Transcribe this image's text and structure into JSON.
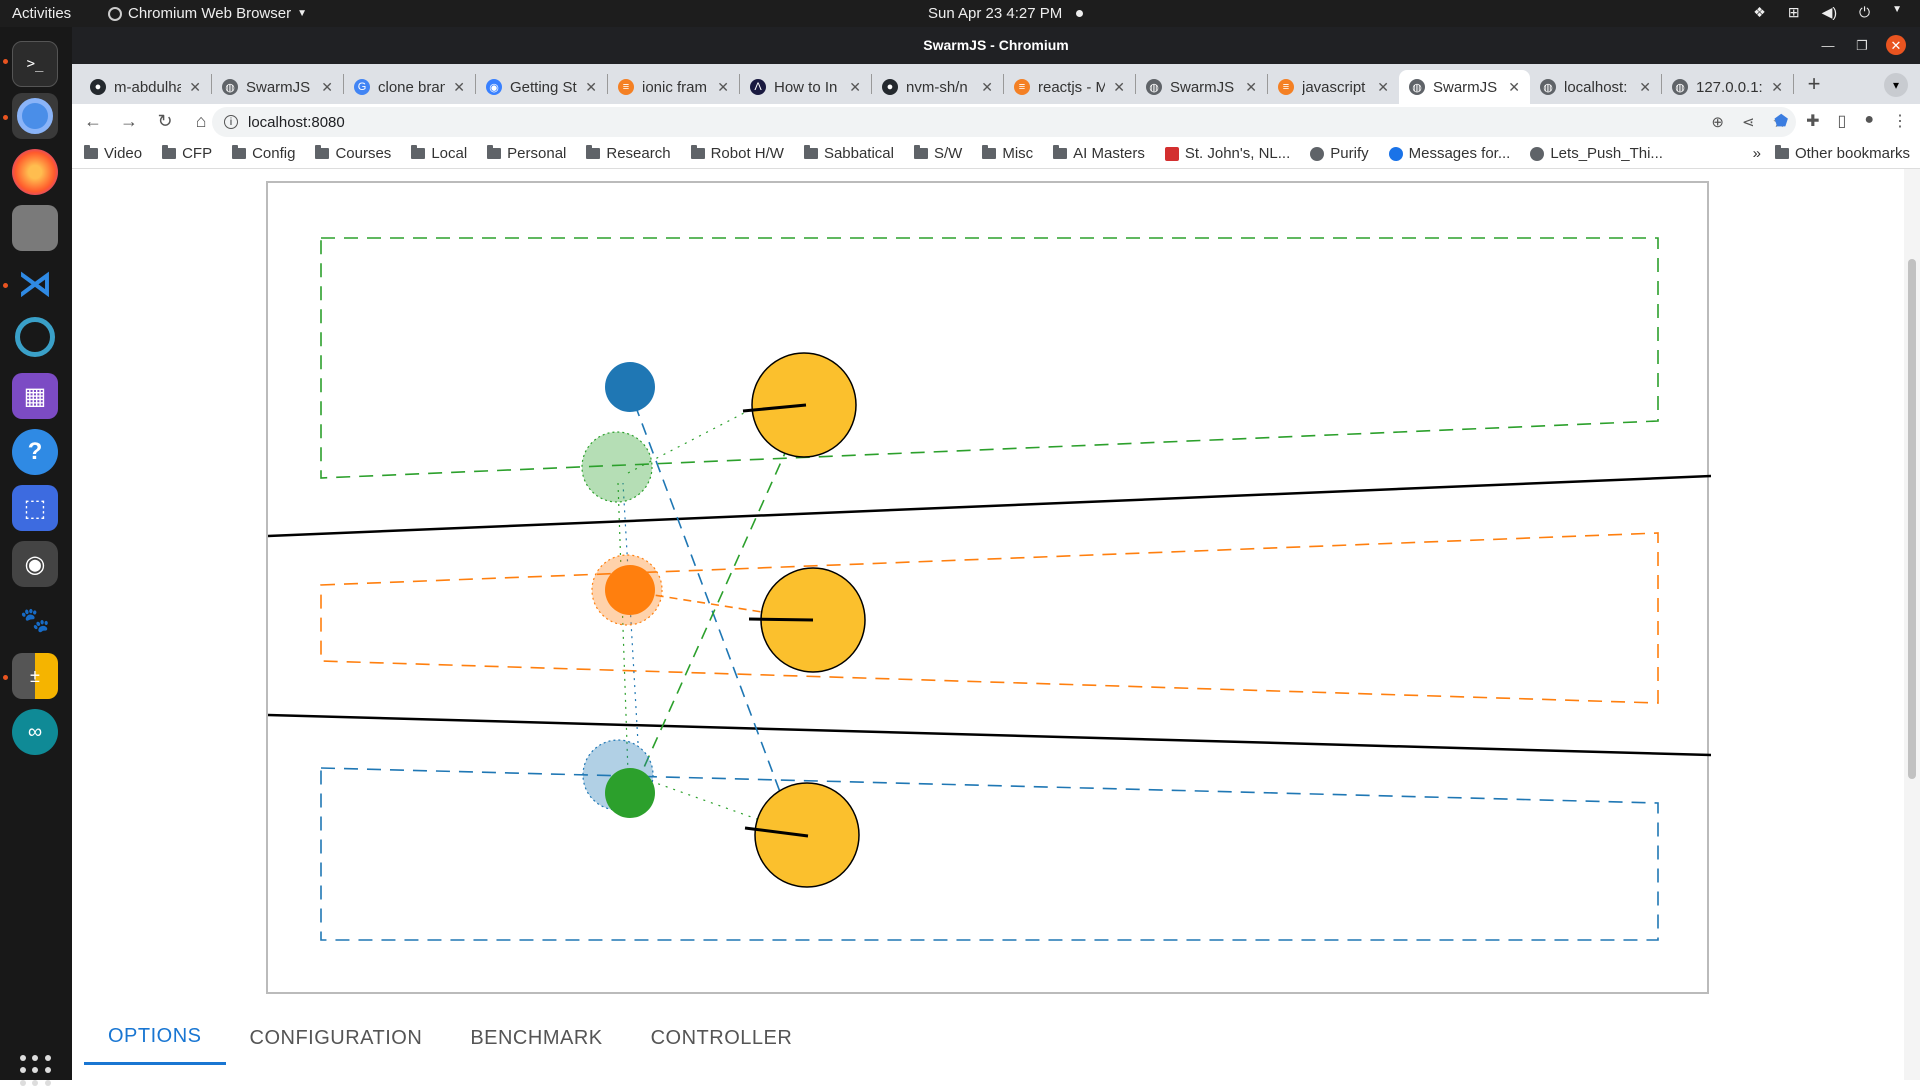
{
  "system_bar": {
    "activities": "Activities",
    "app_name": "Chromium Web Browser",
    "clock": "Sun Apr 23  4:27 PM"
  },
  "dock": {
    "apps": [
      "terminal",
      "chromium",
      "firefox",
      "files",
      "vscode",
      "settings-ring",
      "video-recorder",
      "help",
      "screenshot",
      "camera",
      "gimp",
      "calculator",
      "arduino"
    ]
  },
  "browser": {
    "window_title": "SwarmJS - Chromium",
    "tabs": [
      {
        "label": "m-abdulha",
        "icon": "github-icon",
        "active": false
      },
      {
        "label": "SwarmJS",
        "icon": "globe-icon",
        "active": false
      },
      {
        "label": "clone bran",
        "icon": "google-icon",
        "active": false
      },
      {
        "label": "Getting St",
        "icon": "ionic-icon",
        "active": false
      },
      {
        "label": "ionic fram",
        "icon": "stackoverflow-icon",
        "active": false
      },
      {
        "label": "How to In",
        "icon": "dev-icon",
        "active": false
      },
      {
        "label": "nvm-sh/n",
        "icon": "github-icon",
        "active": false
      },
      {
        "label": "reactjs - M",
        "icon": "stackoverflow-icon",
        "active": false
      },
      {
        "label": "SwarmJS",
        "icon": "globe-icon",
        "active": false
      },
      {
        "label": "javascript",
        "icon": "stackoverflow-icon",
        "active": false
      },
      {
        "label": "SwarmJS",
        "icon": "globe-icon",
        "active": true
      },
      {
        "label": "localhost:",
        "icon": "globe-icon",
        "active": false
      },
      {
        "label": "127.0.0.1:",
        "icon": "globe-icon",
        "active": false
      }
    ],
    "address": "localhost:8080",
    "bookmarks": [
      "Video",
      "CFP",
      "Config",
      "Courses",
      "Local",
      "Personal",
      "Research",
      "Robot H/W",
      "Sabbatical",
      "S/W",
      "Misc",
      "AI Masters",
      "St. John's, NL...",
      "Purify",
      "Messages for...",
      "Lets_Push_Thi..."
    ],
    "bookmarks_more": "»",
    "other_bookmarks": "Other bookmarks"
  },
  "page": {
    "tabs": [
      {
        "label": "OPTIONS",
        "active": true
      },
      {
        "label": "CONFIGURATION",
        "active": false
      },
      {
        "label": "BENCHMARK",
        "active": false
      },
      {
        "label": "CONTROLLER",
        "active": false
      }
    ]
  },
  "colors": {
    "accent": "#1976d2",
    "robot_blue": "#1f77b4",
    "robot_orange": "#ff7f0e",
    "robot_green": "#2ca02c",
    "puck_yellow": "#fbc02d"
  }
}
